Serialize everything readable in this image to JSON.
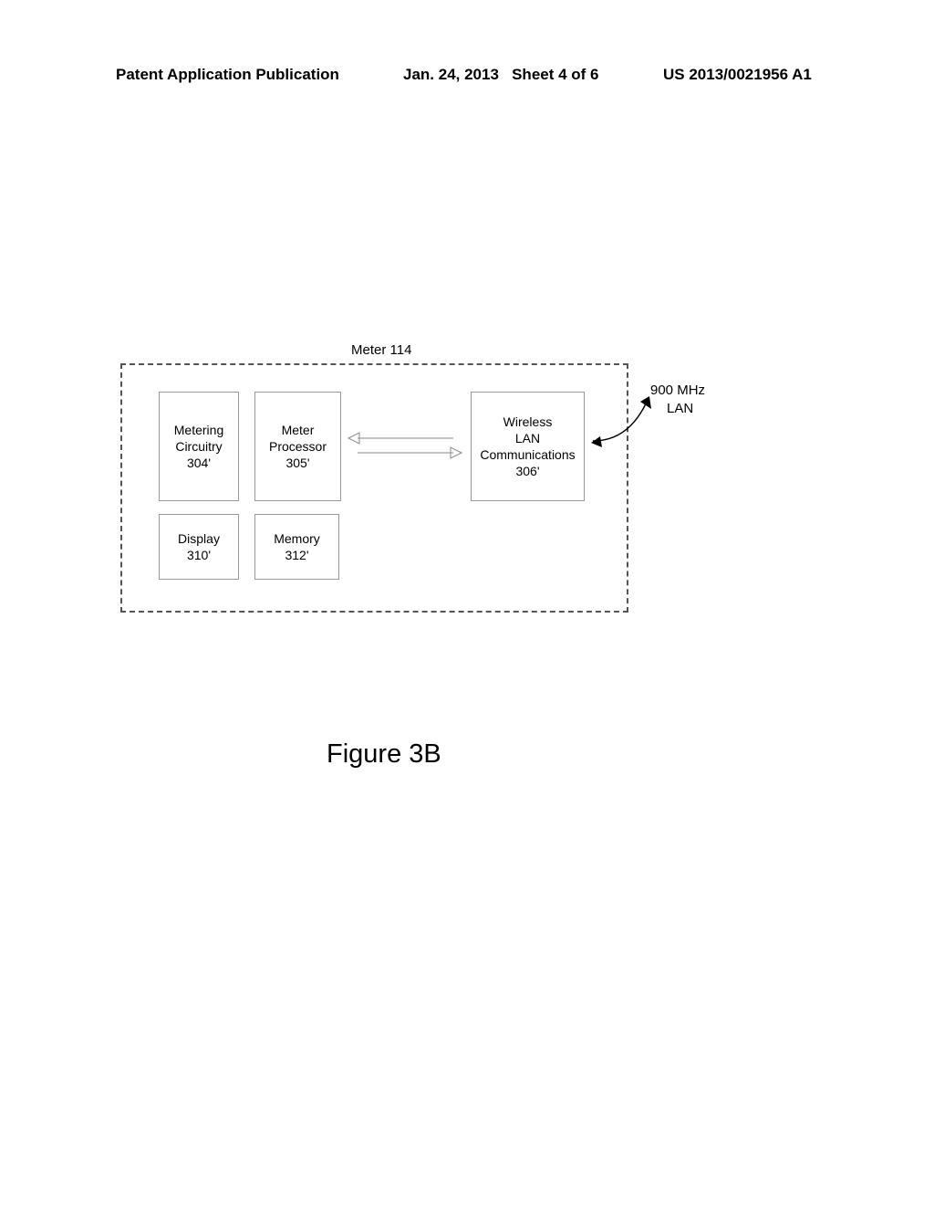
{
  "header": {
    "publication": "Patent Application Publication",
    "date": "Jan. 24, 2013",
    "sheet": "Sheet 4 of 6",
    "patent_number": "US 2013/0021956 A1"
  },
  "diagram": {
    "title": "Meter 114",
    "blocks": {
      "circuitry": {
        "line1": "Metering",
        "line2": "Circuitry",
        "ref": "304'"
      },
      "processor": {
        "line1": "Meter",
        "line2": "Processor",
        "ref": "305'"
      },
      "wireless": {
        "line1": "Wireless",
        "line2": "LAN",
        "line3": "Communications",
        "ref": "306'"
      },
      "display": {
        "line1": "Display",
        "ref": "310'"
      },
      "memory": {
        "line1": "Memory",
        "ref": "312'"
      }
    },
    "external": {
      "line1": "900 MHz",
      "line2": "LAN"
    },
    "figure": "Figure 3B"
  }
}
